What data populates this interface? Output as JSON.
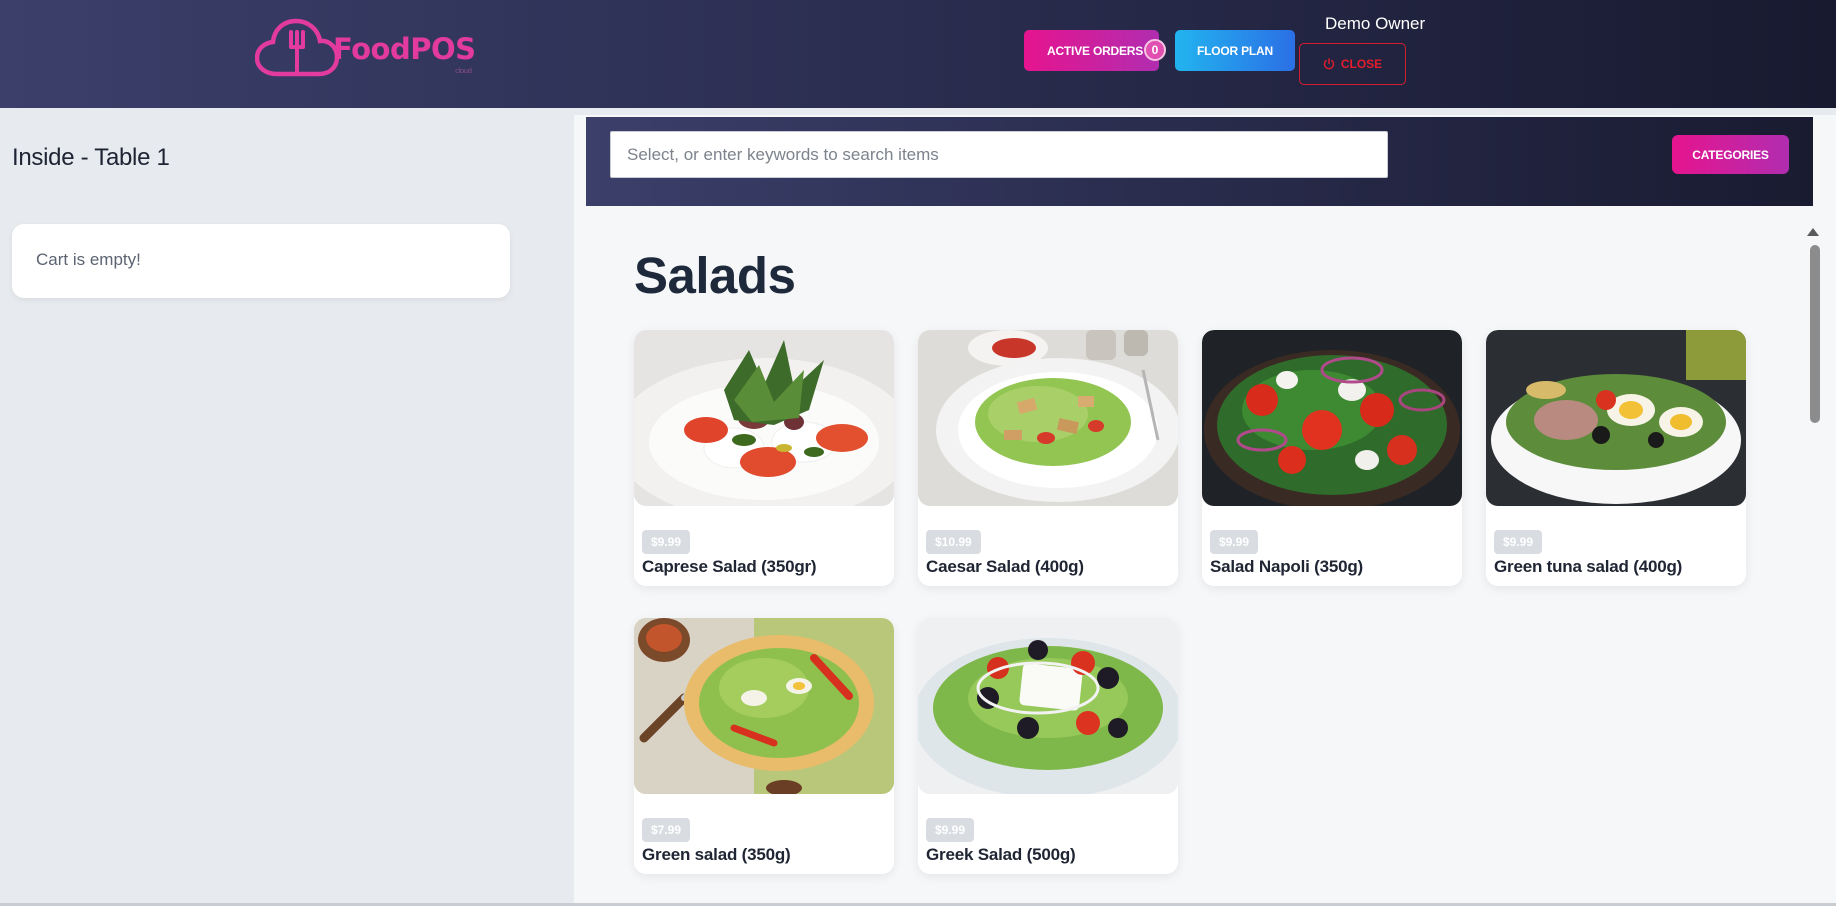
{
  "header": {
    "logo_text": "FoodPOS",
    "logo_sub": "cloud",
    "active_orders_label": "ACTIVE ORDERS",
    "active_orders_count": "0",
    "floor_plan_label": "FLOOR PLAN",
    "user_name": "Demo Owner",
    "close_label": "CLOSE"
  },
  "cart": {
    "table_title": "Inside - Table 1",
    "empty_message": "Cart is empty!"
  },
  "search": {
    "placeholder": "Select, or enter keywords to search items",
    "categories_label": "CATEGORIES"
  },
  "menu": {
    "section_title": "Salads",
    "items": [
      {
        "price": "$9.99",
        "name": "Caprese Salad (350gr)"
      },
      {
        "price": "$10.99",
        "name": "Caesar Salad (400g)"
      },
      {
        "price": "$9.99",
        "name": "Salad Napoli (350g)"
      },
      {
        "price": "$9.99",
        "name": "Green tuna salad (400g)"
      },
      {
        "price": "$7.99",
        "name": "Green salad (350g)"
      },
      {
        "price": "$9.99",
        "name": "Greek Salad (500g)"
      }
    ]
  },
  "colors": {
    "brand_pink": "#e23a9e",
    "accent_blue": "#2b8ff0",
    "danger_red": "#e41c2c",
    "header_dark": "#2c2f52"
  }
}
